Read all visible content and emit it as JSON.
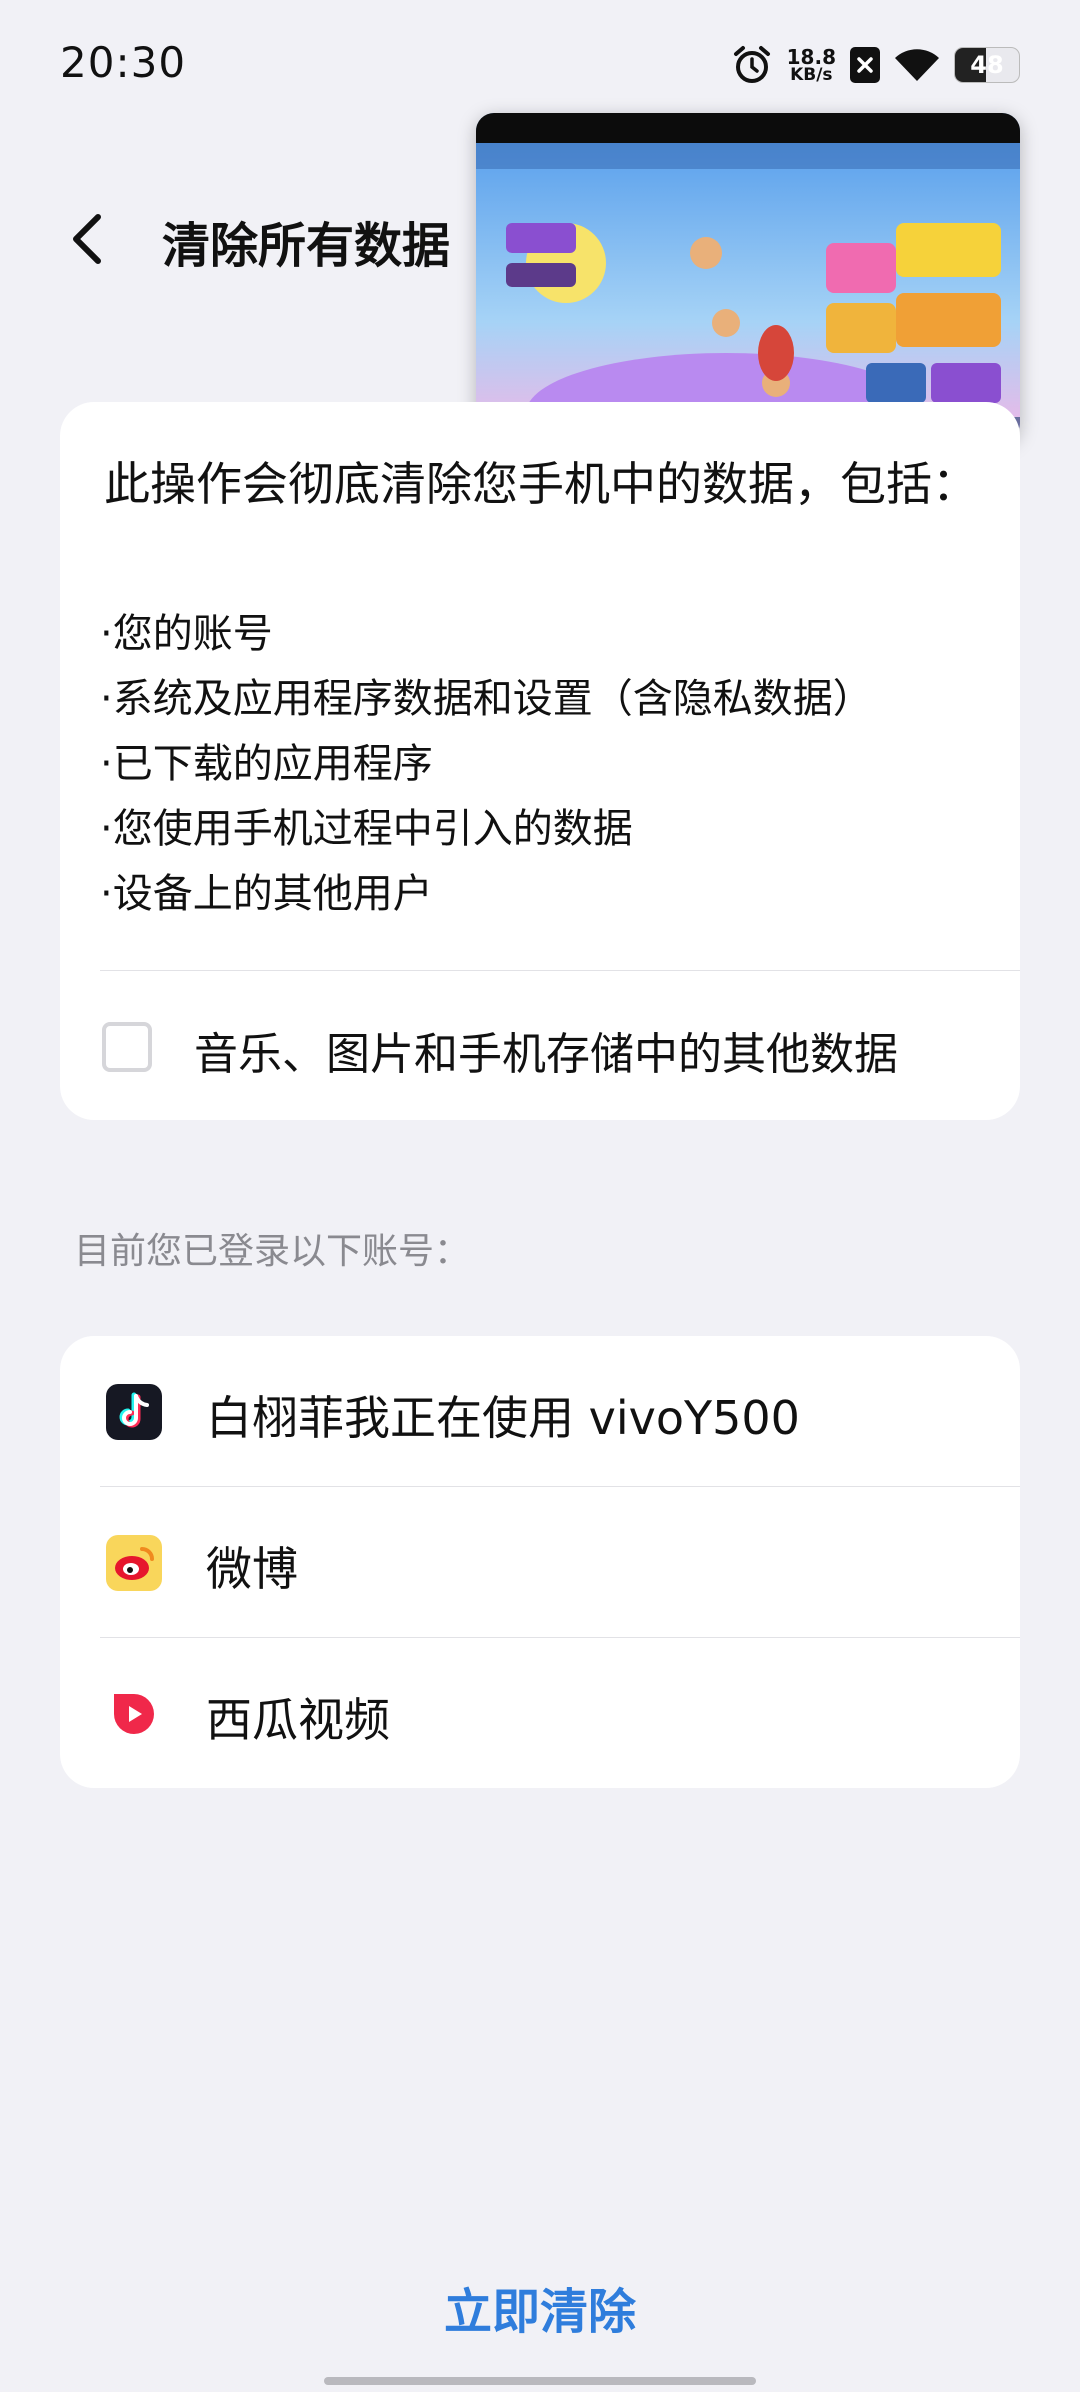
{
  "status_bar": {
    "time": "20:30",
    "net_speed_value": "18.8",
    "net_speed_unit": "KB/s",
    "battery_level": "48",
    "battery_fraction": 0.48,
    "icons": [
      "alarm-icon",
      "no-sim-icon",
      "wifi-icon",
      "battery-icon"
    ]
  },
  "header": {
    "title": "清除所有数据"
  },
  "warning": {
    "title": "此操作会彻底清除您手机中的数据，包括：",
    "items": [
      "您的账号",
      "系统及应用程序数据和设置（含隐私数据）",
      "已下载的应用程序",
      "您使用手机过程中引入的数据",
      "设备上的其他用户"
    ],
    "checkbox_label": "音乐、图片和手机存储中的其他数据",
    "checkbox_checked": false
  },
  "accounts": {
    "section_label": "目前您已登录以下账号：",
    "items": [
      {
        "label": "白栩菲我正在使用 vivoY500",
        "icon": "tiktok-icon"
      },
      {
        "label": "微博",
        "icon": "weibo-icon"
      },
      {
        "label": "西瓜视频",
        "icon": "xigua-video-icon"
      }
    ]
  },
  "actions": {
    "clear_now": "立即清除"
  },
  "colors": {
    "background": "#f1f1f6",
    "accent": "#2f7ddc",
    "card": "#ffffff"
  }
}
